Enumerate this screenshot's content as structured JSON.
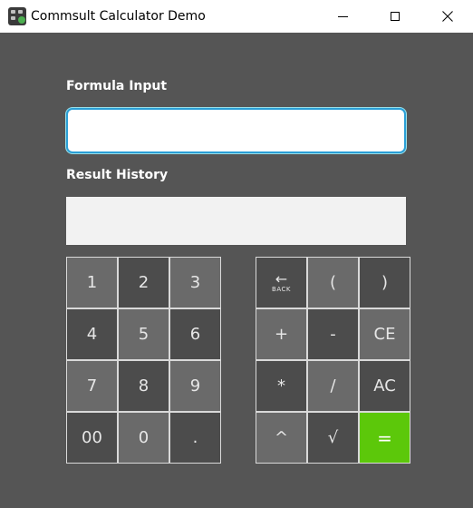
{
  "window": {
    "title": "Commsult Calculator Demo",
    "app_icon": "calculator-app-icon",
    "controls": {
      "minimize": "minimize-icon",
      "maximize": "maximize-icon",
      "close": "close-icon"
    }
  },
  "formula": {
    "label": "Formula Input",
    "value": "",
    "placeholder": ""
  },
  "history": {
    "label": "Result History",
    "value": ""
  },
  "number_pad": {
    "keys": [
      "1",
      "2",
      "3",
      "4",
      "5",
      "6",
      "7",
      "8",
      "9",
      "00",
      "0",
      "."
    ]
  },
  "operator_pad": {
    "back_label": "BACK",
    "back_icon": "back-arrow-icon",
    "keys": [
      "(",
      ")",
      "+",
      "-",
      "CE",
      "*",
      "/",
      "AC",
      "^",
      "√",
      "="
    ]
  },
  "colors": {
    "background": "#555555",
    "input_border": "#2a9fd6",
    "equals": "#5cc80a",
    "key_light": "#6a6a6a",
    "key_dark": "#4c4c4c"
  }
}
